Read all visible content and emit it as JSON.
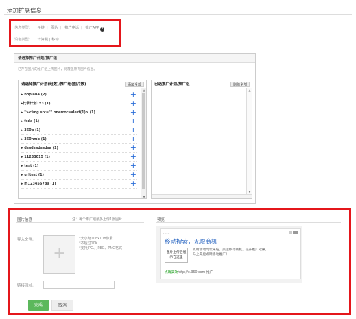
{
  "page": {
    "title": "添加扩展信息"
  },
  "info_type": {
    "label": "信息类型：",
    "options": [
      "子链",
      "图片",
      "推广电话",
      "推广APP"
    ],
    "help_icon": "question-circle-icon"
  },
  "device_type": {
    "label": "设备类型：",
    "value": "计算机 | 移动"
  },
  "plan_panel": {
    "header": "请选择推广计划/推广组",
    "tip": "已存在图片的推广组上传图片，将覆盖原有图片信息。",
    "left": {
      "title": "请选择推广计划(组数)/推广组(图片数)",
      "add_all": "添加全部",
      "items": [
        "▸ boplan4 (2)",
        "▸比例计划1x3 (1)",
        "▸ \"><img src=\"\" onerror=alert(1)> (1)",
        "▸ fsda (1)",
        "▸ 360p (1)",
        "▸ 360nmb (1)",
        "▸ dsadsadsadsa (1)",
        "▸ 11233015 (1)",
        "▸ test (1)",
        "▸ urltest (1)",
        "▸ m123456789 (1)"
      ],
      "add_symbol": "+"
    },
    "right": {
      "title": "已选推广计划/推广组",
      "delete_all": "删除全部"
    }
  },
  "image_info": {
    "title": "图片信息",
    "note": "注：每个推广组最多上传1张图片",
    "import_label": "导入文件:",
    "upload_plus": "+",
    "hints": [
      "*大小为108x108像素",
      "*不超过10K",
      "*支持JPG、JPEG、PNG格式"
    ],
    "link_label": "链接网址:",
    "link_value": "",
    "done": "完成",
    "cancel": "取消"
  },
  "preview": {
    "title": "预览",
    "dots": "......",
    "ad_title": "移动搜索，无限商机",
    "image_btn": [
      "图片上传后展",
      "示在这里"
    ],
    "desc": [
      "点睛移动时代来临，关注移动商机，提升推广效果，",
      "马上开启点睛移动推广！"
    ],
    "url_brand": "点睛实效",
    "url_text": "http://e.360.com 推广"
  },
  "colors": {
    "highlight": "#e4161b",
    "accent_blue": "#2b6ed8",
    "done_green": "#5cb85c",
    "link_blue": "#1f5fbf"
  }
}
